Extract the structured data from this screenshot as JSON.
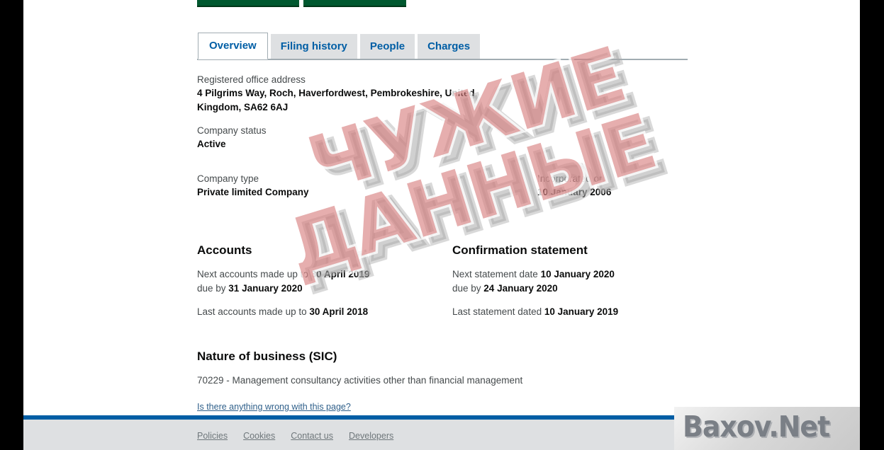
{
  "tabs": [
    {
      "label": "Overview",
      "active": true
    },
    {
      "label": "Filing history",
      "active": false
    },
    {
      "label": "People",
      "active": false
    },
    {
      "label": "Charges",
      "active": false
    }
  ],
  "overview": {
    "address_label": "Registered office address",
    "address_value": "4 Pilgrims Way, Roch, Haverfordwest, Pembrokeshire, United Kingdom, SA62 6AJ",
    "status_label": "Company status",
    "status_value": "Active",
    "type_label": "Company type",
    "type_value": "Private limited Company",
    "incorporated_label": "Incorporated on",
    "incorporated_value": "10 January 2006"
  },
  "accounts": {
    "heading": "Accounts",
    "next_prefix": "Next accounts made up to ",
    "next_date": "30 April 2019",
    "due_prefix": "due by ",
    "due_date": "31 January 2020",
    "last_prefix": "Last accounts made up to ",
    "last_date": "30 April 2018"
  },
  "confirmation": {
    "heading": "Confirmation statement",
    "next_prefix": "Next statement date ",
    "next_date": "10 January 2020",
    "due_prefix": "due by ",
    "due_date": "24 January 2020",
    "last_prefix": "Last statement dated ",
    "last_date": "10 January 2019"
  },
  "sic": {
    "heading": "Nature of business (SIC)",
    "entry": "70229 - Management consultancy activities other than financial management"
  },
  "feedback_link": "Is there anything wrong with this page?",
  "footer": {
    "links": [
      "Policies",
      "Cookies",
      "Contact us",
      "Developers"
    ]
  },
  "watermarks": {
    "diagonal_line1": "ЧУЖИЕ",
    "diagonal_line2": "ДАННЫЕ",
    "site": "Baxov.Net"
  },
  "colors": {
    "link_blue": "#005ea5",
    "tab_inactive_bg": "#dee0e2",
    "footer_border": "#005ea5",
    "green_button": "#00582f",
    "watermark_pink": "#d67c7c"
  }
}
